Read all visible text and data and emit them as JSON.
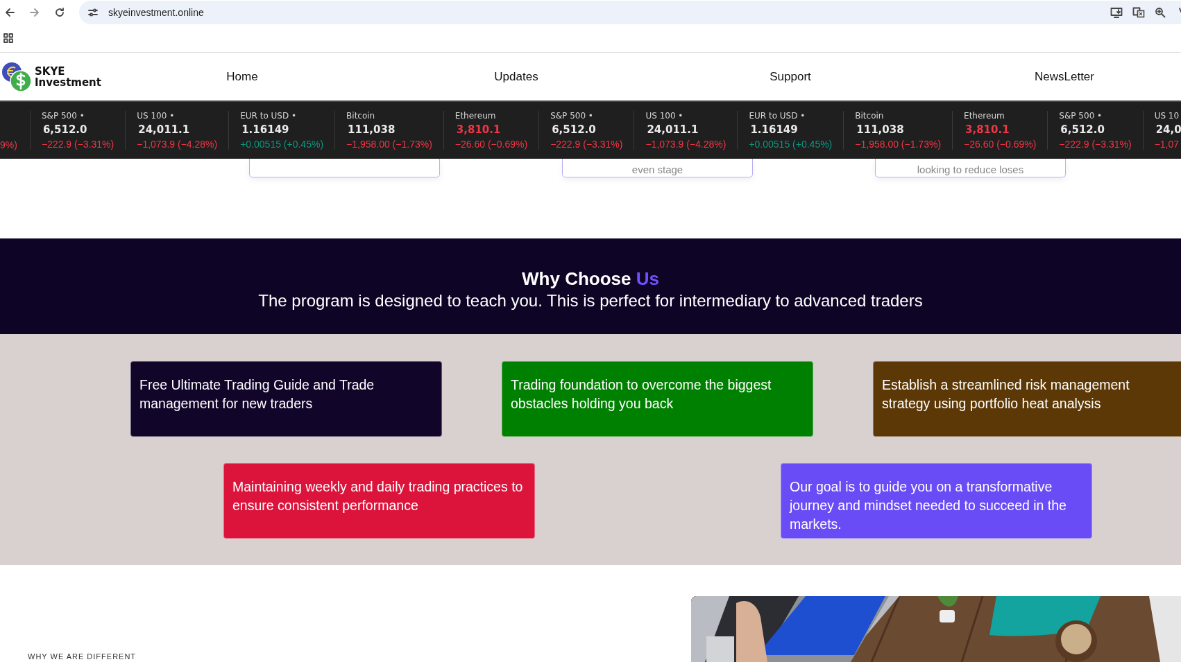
{
  "browser": {
    "url": "skyeinvestment.online"
  },
  "header": {
    "logo_line_1": "SKYE",
    "logo_line_2": "Investment",
    "nav": [
      {
        "label": "Home"
      },
      {
        "label": "Updates"
      },
      {
        "label": "Support"
      },
      {
        "label": "NewsLetter"
      }
    ]
  },
  "ticker": {
    "leading_fragment": "9%)",
    "items": [
      {
        "name": "S&P 500 •",
        "price": "6,512.0",
        "change": "−222.9 (−3.31%)",
        "color": "#f23645",
        "price_highlight": false
      },
      {
        "name": "US 100 •",
        "price": "24,011.1",
        "change": "−1,073.9 (−4.28%)",
        "color": "#f23645",
        "price_highlight": false
      },
      {
        "name": "EUR to USD •",
        "price": "1.16149",
        "change": "+0.00515 (+0.45%)",
        "color": "#089981",
        "price_highlight": false
      },
      {
        "name": "Bitcoin",
        "price": "111,038",
        "change": "−1,958.00 (−1.73%)",
        "color": "#f23645",
        "price_highlight": false
      },
      {
        "name": "Ethereum",
        "price": "3,810.1",
        "change": "−26.60 (−0.69%)",
        "color": "#f23645",
        "price_highlight": true
      },
      {
        "name": "S&P 500 •",
        "price": "6,512.0",
        "change": "−222.9 (−3.31%)",
        "color": "#f23645",
        "price_highlight": false
      },
      {
        "name": "US 100 •",
        "price": "24,011.1",
        "change": "−1,073.9 (−4.28%)",
        "color": "#f23645",
        "price_highlight": false
      },
      {
        "name": "EUR to USD •",
        "price": "1.16149",
        "change": "+0.00515 (+0.45%)",
        "color": "#089981",
        "price_highlight": false
      },
      {
        "name": "Bitcoin",
        "price": "111,038",
        "change": "−1,958.00 (−1.73%)",
        "color": "#f23645",
        "price_highlight": false
      },
      {
        "name": "Ethereum",
        "price": "3,810.1",
        "change": "−26.60 (−0.69%)",
        "color": "#f23645",
        "price_highlight": true
      },
      {
        "name": "S&P 500 •",
        "price": "6,512.0",
        "change": "−222.9 (−3.31%)",
        "color": "#f23645",
        "price_highlight": false
      },
      {
        "name": "US 10",
        "price": "24,0",
        "change": "−1,07",
        "color": "#f23645",
        "price_highlight": false
      }
    ]
  },
  "upper_cards": [
    {
      "kind": "blank"
    },
    {
      "kind": "text",
      "text": "even stage"
    },
    {
      "kind": "text",
      "text": "looking to reduce loses"
    }
  ],
  "why_choose": {
    "title": "Why Choose",
    "title_accent": "Us",
    "subtitle": "The program is designed to teach you. This is perfect for intermediary to advanced traders"
  },
  "features": [
    {
      "text": "Free Ultimate Trading Guide and Trade management for new traders",
      "color": "#12052a"
    },
    {
      "text": "Trading foundation to overcome the biggest obstacles holding you back",
      "color": "#008000"
    },
    {
      "text": "Establish a streamlined risk management strategy using portfolio heat analysis",
      "color": "#5c3806"
    },
    {
      "text": "Maintaining weekly and daily trading practices to ensure consistent performance",
      "color": "#dc143c"
    },
    {
      "text": "Our goal is to guide you on a transformative journey and mindset needed to succeed in the markets.",
      "color": "#6a4cf6"
    }
  ],
  "different": {
    "eyebrow": "WHY WE ARE DIFFERENT"
  }
}
